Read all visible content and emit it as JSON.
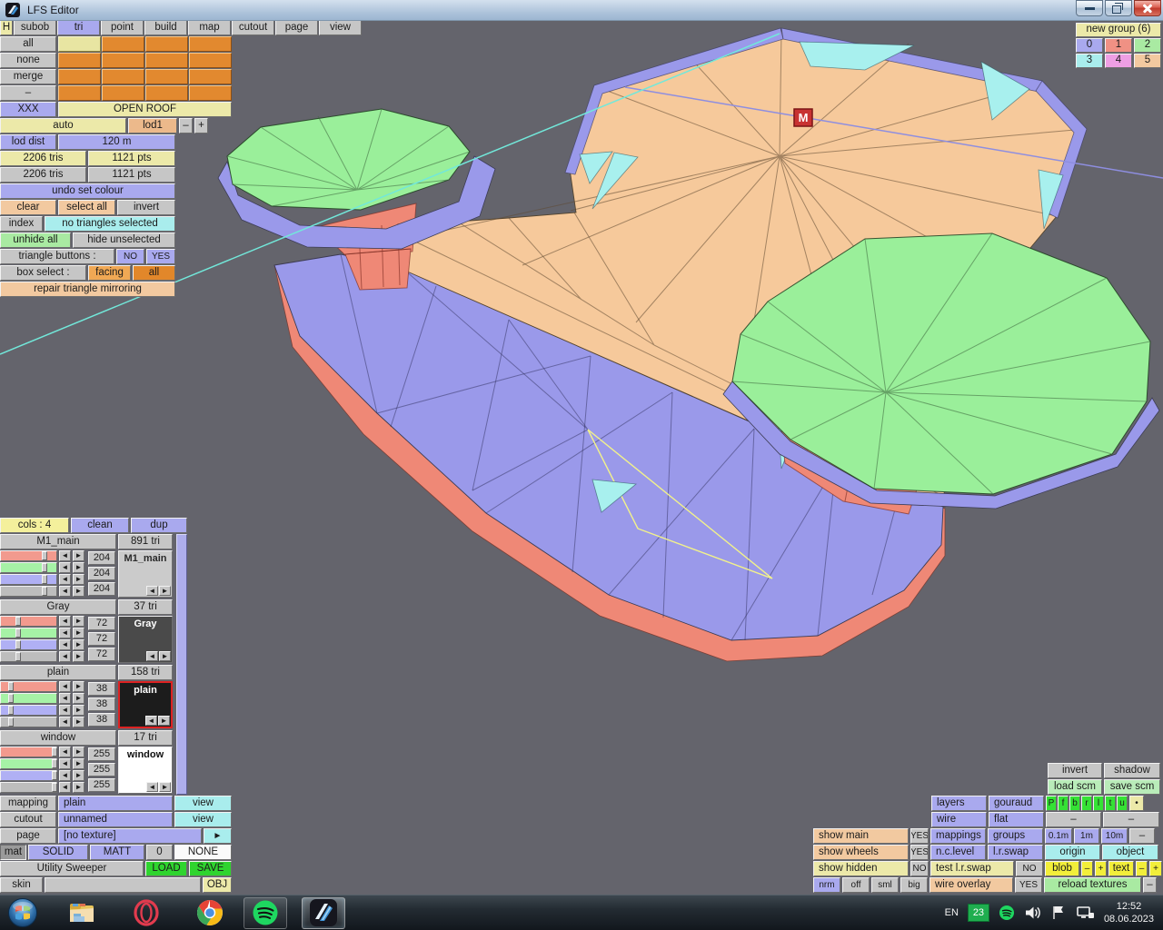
{
  "window": {
    "title": "LFS Editor"
  },
  "menu": {
    "items": [
      "H",
      "subob",
      "tri",
      "point",
      "build",
      "map",
      "cutout",
      "page",
      "view"
    ],
    "active": "tri"
  },
  "left_top": {
    "rows": [
      "all",
      "none",
      "merge",
      "–"
    ],
    "xxx": "XXX",
    "open_roof": "OPEN ROOF",
    "auto": "auto",
    "lod": "lod1",
    "minus": "–",
    "plus": "+",
    "lod_dist_label": "lod dist",
    "lod_dist_value": "120 m",
    "tris_1": "2206 tris",
    "pts_1": "1121 pts",
    "tris_2": "2206 tris",
    "pts_2": "1121 pts",
    "undo": "undo set colour",
    "clear": "clear",
    "select_all": "select all",
    "invert": "invert",
    "index": "index",
    "selection_status": "no triangles selected",
    "unhide_all": "unhide all",
    "hide_unselected": "hide unselected",
    "triangle_buttons_label": "triangle buttons :",
    "no": "NO",
    "yes": "YES",
    "box_select_label": "box select :",
    "facing": "facing",
    "all": "all",
    "repair": "repair triangle mirroring"
  },
  "groups": {
    "title": "new group (6)",
    "buttons": [
      "0",
      "1",
      "2",
      "3",
      "4",
      "5"
    ]
  },
  "materials": {
    "cols": "cols : 4",
    "clean": "clean",
    "dup": "dup",
    "list": [
      {
        "name": "M1_main",
        "tri": "891 tri",
        "r": "204",
        "g": "204",
        "b": "204",
        "preview": "M1_main",
        "preview_bg": "#cbcbcb",
        "preview_fg": "#2a2a2a",
        "selected": false
      },
      {
        "name": "Gray",
        "tri": "37 tri",
        "r": "72",
        "g": "72",
        "b": "72",
        "preview": "Gray",
        "preview_bg": "#4a4a4a",
        "preview_fg": "#ffffff",
        "selected": false
      },
      {
        "name": "plain",
        "tri": "158 tri",
        "r": "38",
        "g": "38",
        "b": "38",
        "preview": "plain",
        "preview_bg": "#1c1c1c",
        "preview_fg": "#ffffff",
        "selected": true
      },
      {
        "name": "window",
        "tri": "17 tri",
        "r": "255",
        "g": "255",
        "b": "255",
        "preview": "window",
        "preview_bg": "#ffffff",
        "preview_fg": "#111111",
        "selected": false
      }
    ]
  },
  "icons": {
    "left": "◄",
    "right": "►",
    "dot": "•"
  },
  "mapping_panel": {
    "mapping_label": "mapping",
    "mapping_value": "plain",
    "mapping_view": "view",
    "cutout_label": "cutout",
    "cutout_value": "unnamed",
    "cutout_view": "view",
    "page_label": "page",
    "page_value": "[no texture]",
    "page_arrow": "►",
    "mat_label": "mat",
    "mat_solid": "SOLID",
    "mat_matt": "MATT",
    "mat_num": "0",
    "mat_none": "NONE",
    "vehicle": "Utility Sweeper",
    "load": "LOAD",
    "save": "SAVE",
    "skin_label": "skin",
    "obj": "OBJ"
  },
  "right_panel": {
    "invert": "invert",
    "shadow": "shadow",
    "load_scm": "load scm",
    "save_scm": "save scm",
    "layers": "layers",
    "gouraud": "gouraud",
    "layer_keys": [
      "P",
      "f",
      "b",
      "r",
      "l",
      "t",
      "u"
    ],
    "dot": "•",
    "wire": "wire",
    "flat": "flat",
    "dash": "–",
    "mappings": "mappings",
    "groups": "groups",
    "m01": "0.1m",
    "m1": "1m",
    "m10": "10m",
    "show_main": "show main",
    "show_main_val": "YES",
    "ncl": "n.c.level",
    "lrs": "l.r.swap",
    "origin": "origin",
    "object": "object",
    "show_wheels": "show wheels",
    "show_wheels_val": "YES",
    "show_hidden": "show hidden",
    "show_hidden_val": "NO",
    "test_lr": "test l.r.swap",
    "test_lr_val": "NO",
    "blob": "blob",
    "text": "text",
    "minus": "–",
    "plus": "+",
    "nrm": "nrm",
    "off": "off",
    "sml": "sml",
    "big": "big",
    "wire_overlay": "wire overlay",
    "wire_overlay_val": "YES",
    "reload": "reload textures"
  },
  "viewport": {
    "marker": "M"
  },
  "taskbar": {
    "tray": {
      "lang": "EN",
      "badge": "23",
      "time": "12:52",
      "date": "08.06.2023"
    }
  },
  "colors": {
    "body_orange": "#f6c99b",
    "body_purple": "#9a99ea",
    "wheel_green": "#9aef9a",
    "hub_salmon": "#ef8876",
    "window_cyan": "#a8f0ee",
    "viewport_bg": "#64646c"
  }
}
